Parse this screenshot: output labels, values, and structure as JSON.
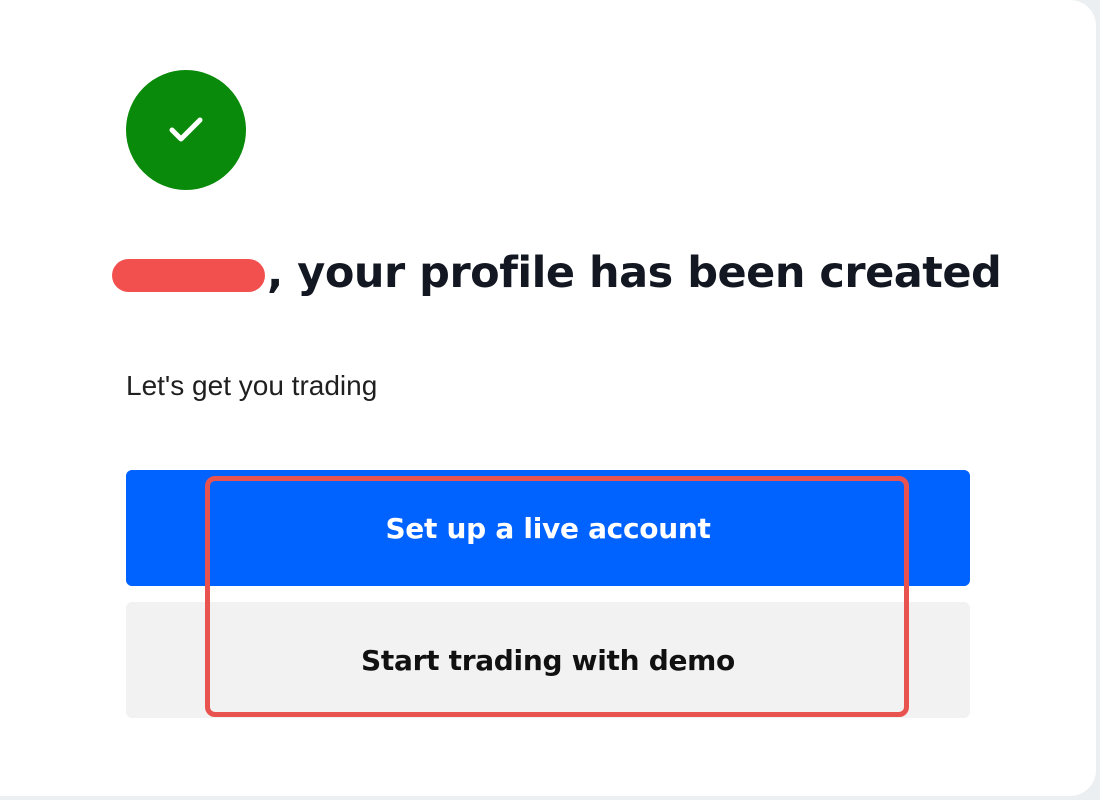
{
  "icons": {
    "success": "check-circle-icon"
  },
  "colors": {
    "success_green": "#0a8a0a",
    "primary_blue": "#0062ff",
    "secondary_gray": "#f2f2f2",
    "redaction_red": "#f2504f",
    "highlight_red": "#e9534f",
    "heading_text": "#131722"
  },
  "heading": {
    "text": ", your profile has been created"
  },
  "subtitle": "Let's get you trading",
  "actions": {
    "live_label": "Set up a live account",
    "demo_label": "Start trading with demo"
  }
}
